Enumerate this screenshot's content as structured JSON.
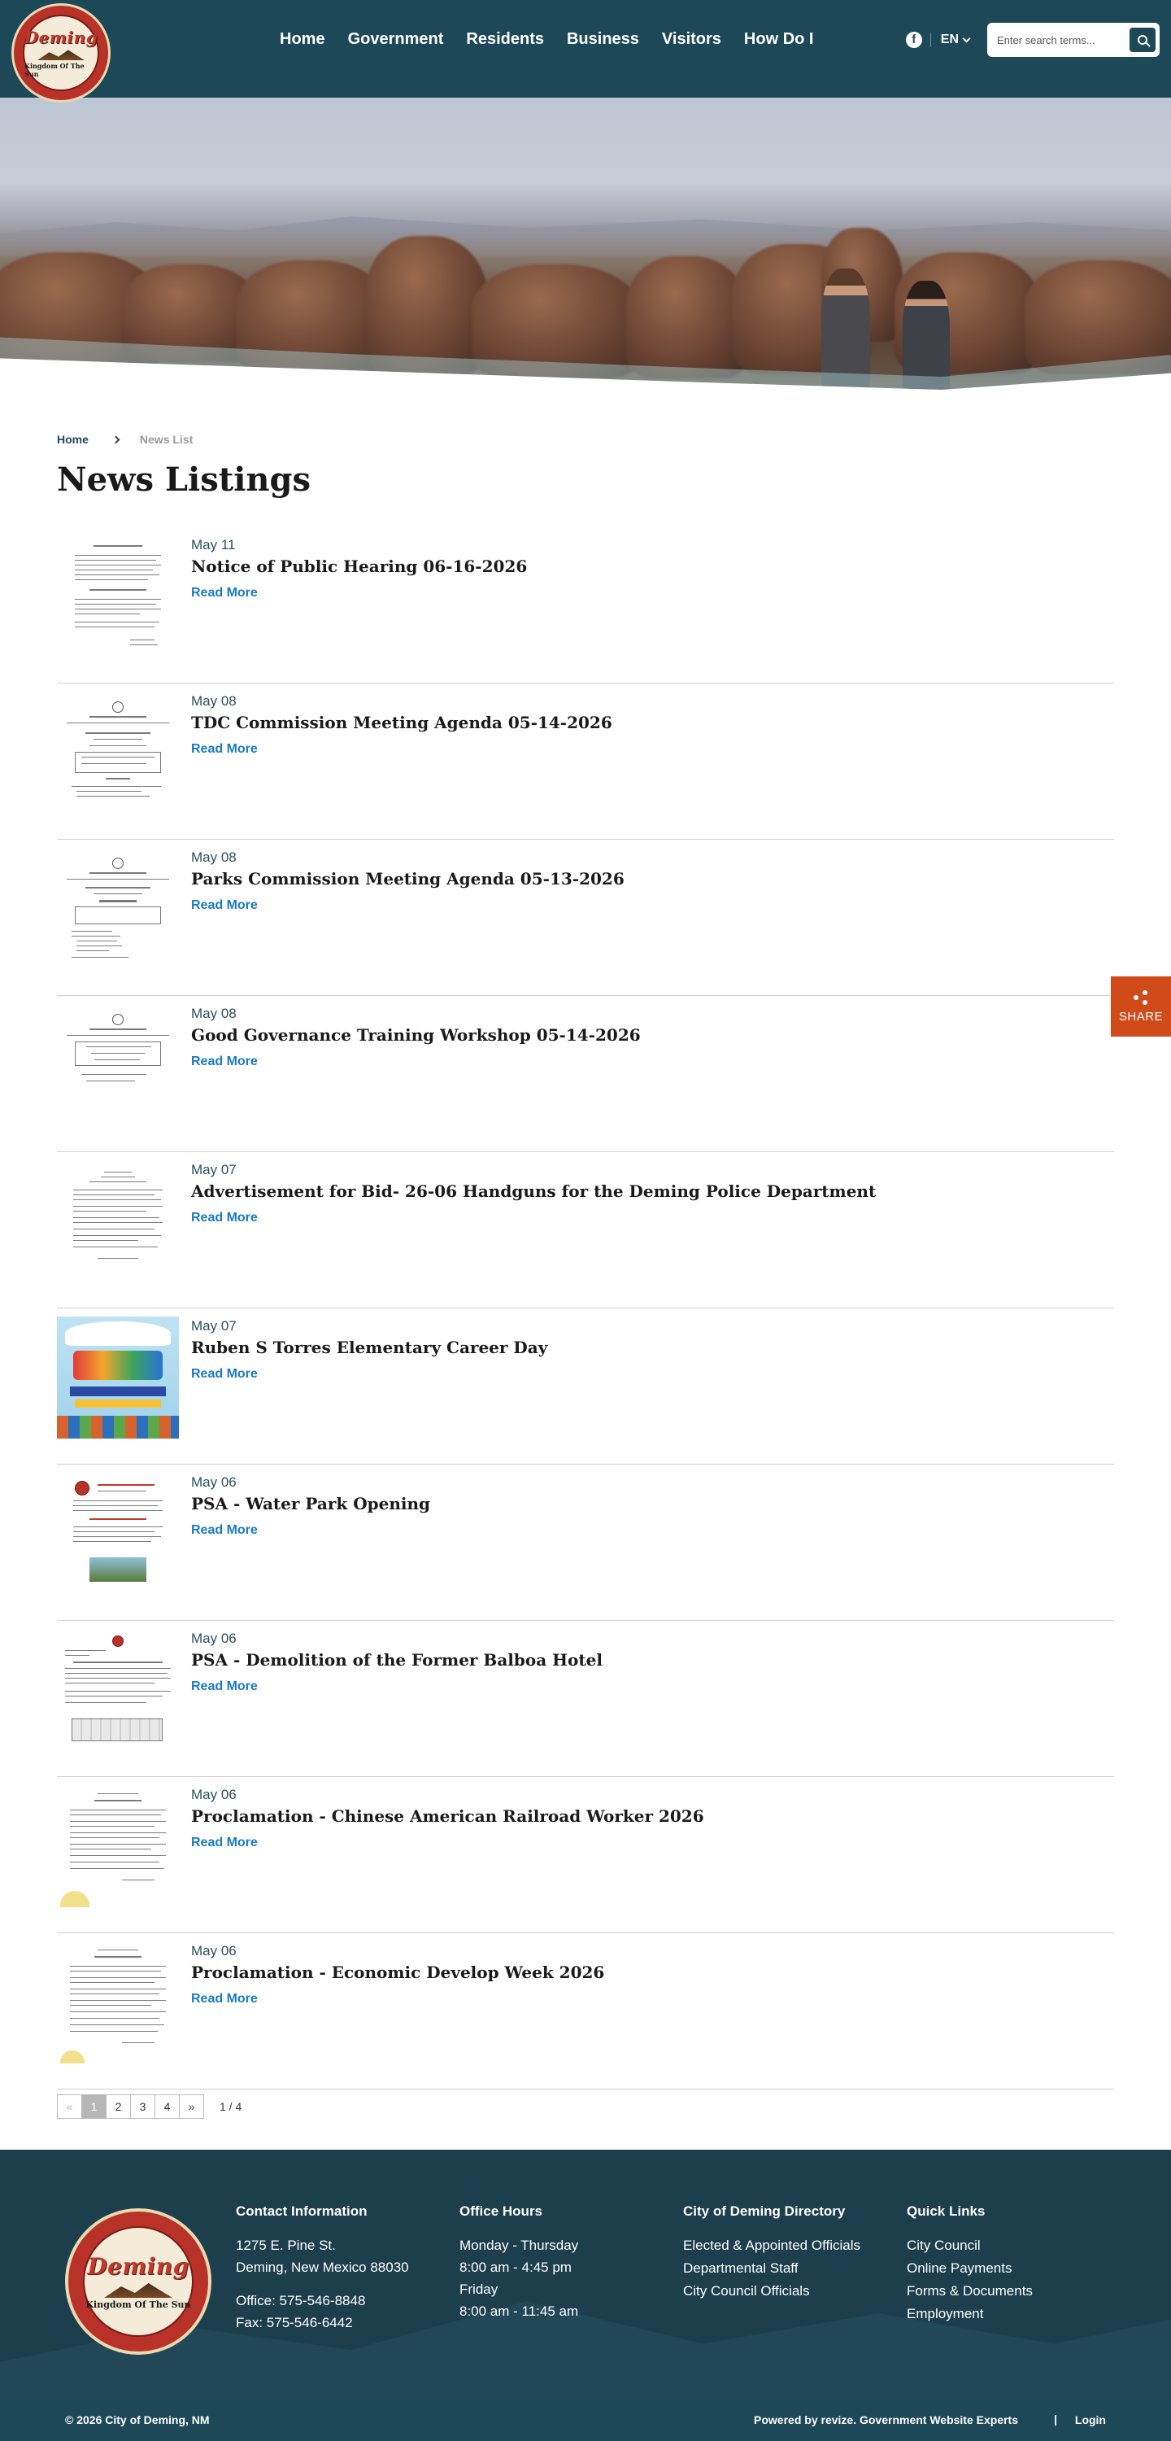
{
  "header": {
    "logo_alt": "Deming Kingdom Of The Sun",
    "logo_word": "Deming",
    "logo_tag": "Kingdom Of The Sun",
    "nav": [
      "Home",
      "Government",
      "Residents",
      "Business",
      "Visitors",
      "How Do I"
    ],
    "facebook_icon": "facebook-icon",
    "language": "EN",
    "search_placeholder": "Enter search terms...",
    "search_icon": "search-icon"
  },
  "breadcrumb": {
    "home": "Home",
    "current": "News List"
  },
  "page_title": "News Listings",
  "news": [
    {
      "date": "May 11",
      "title": "Notice of Public Hearing 06-16-2026",
      "read_more": "Read More"
    },
    {
      "date": "May 08",
      "title": "TDC Commission Meeting Agenda 05-14-2026",
      "read_more": "Read More"
    },
    {
      "date": "May 08",
      "title": "Parks Commission Meeting Agenda 05-13-2026",
      "read_more": "Read More"
    },
    {
      "date": "May 08",
      "title": "Good Governance Training Workshop 05-14-2026",
      "read_more": "Read More"
    },
    {
      "date": "May 07",
      "title": "Advertisement for Bid- 26-06 Handguns for the Deming Police Department",
      "read_more": "Read More"
    },
    {
      "date": "May 07",
      "title": "Ruben S Torres Elementary Career Day",
      "read_more": "Read More"
    },
    {
      "date": "May 06",
      "title": "PSA - Water Park Opening",
      "read_more": "Read More"
    },
    {
      "date": "May 06",
      "title": "PSA - Demolition of the Former Balboa Hotel",
      "read_more": "Read More"
    },
    {
      "date": "May 06",
      "title": "Proclamation - Chinese American Railroad Worker 2026",
      "read_more": "Read More"
    },
    {
      "date": "May 06",
      "title": "Proclamation - Economic Develop Week 2026",
      "read_more": "Read More"
    }
  ],
  "pagination": {
    "prev": "«",
    "pages": [
      "1",
      "2",
      "3",
      "4"
    ],
    "next": "»",
    "current": 1,
    "count_text": "1 / 4"
  },
  "share": {
    "label": "SHARE",
    "icon": "share-icon"
  },
  "footer": {
    "contact": {
      "heading": "Contact Information",
      "address1": "1275 E. Pine St.",
      "address2": "Deming, New Mexico 88030",
      "office": "Office: 575-546-8848",
      "fax": "Fax: 575-546-6442"
    },
    "hours": {
      "heading": "Office Hours",
      "line1": "Monday - Thursday",
      "line2": "8:00 am - 4:45 pm",
      "line3": "Friday",
      "line4": "8:00 am - 11:45 am"
    },
    "directory": {
      "heading": "City of Deming Directory",
      "links": [
        "Elected & Appointed Officials",
        "Departmental Staff",
        "City Council Officials"
      ]
    },
    "quick": {
      "heading": "Quick Links",
      "links": [
        "City Council",
        "Online Payments",
        "Forms & Documents",
        "Employment"
      ]
    },
    "copyright": "© 2026 City of Deming, NM",
    "powered": "Powered by revize. Government Website Experts",
    "separator": "|",
    "login": "Login"
  },
  "colors": {
    "header_bg": "#1d4858",
    "link": "#1a7bc4",
    "share_bg": "#d14a1a",
    "footer_bg": "#1d3e4c"
  }
}
